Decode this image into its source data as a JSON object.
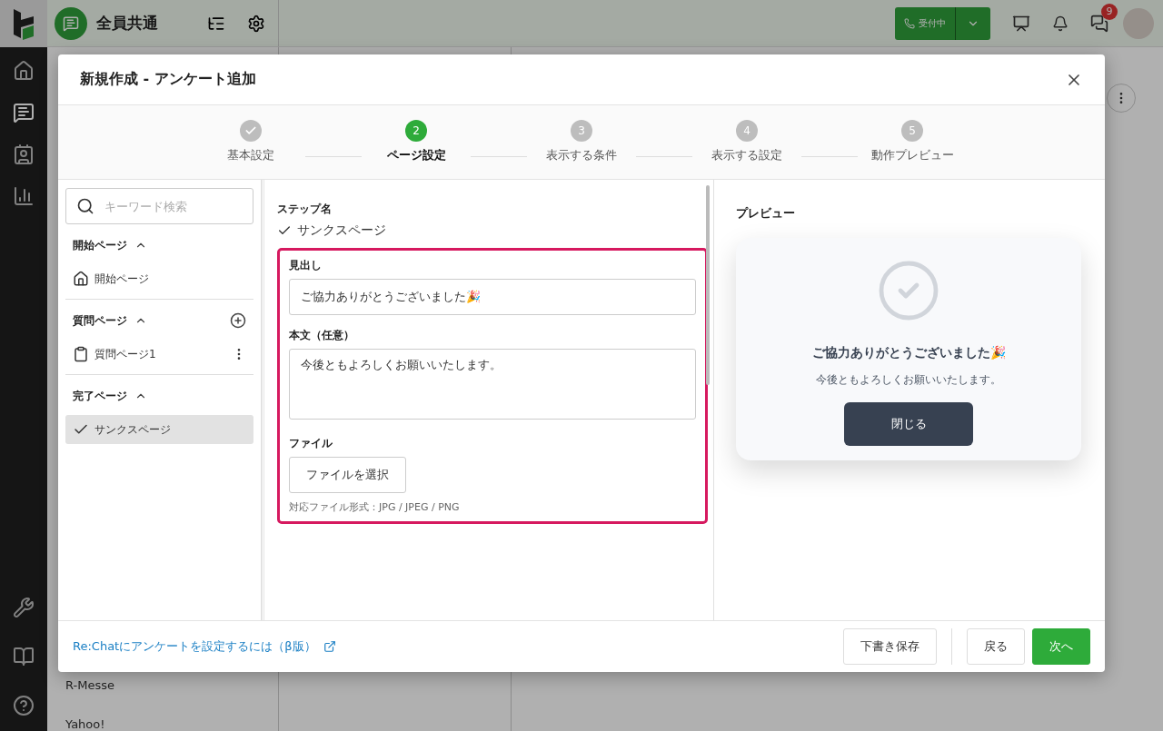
{
  "app": {
    "workspace": "全員共通",
    "status_button": "受付中",
    "notification_count": "9",
    "list_items": [
      "R-Messe",
      "Yahoo!"
    ]
  },
  "nav": [
    {
      "kind": "home",
      "selected": false
    },
    {
      "kind": "inbox",
      "selected": true
    },
    {
      "kind": "contacts",
      "selected": false
    },
    {
      "kind": "chart",
      "selected": false
    }
  ],
  "nav_bottom": [
    {
      "kind": "tools"
    },
    {
      "kind": "book"
    },
    {
      "kind": "help"
    }
  ],
  "dialog": {
    "title": "新規作成 - アンケート追加",
    "steps": [
      {
        "label": "基本設定",
        "kind": "done"
      },
      {
        "label": "ページ設定",
        "kind": "current",
        "number": "2"
      },
      {
        "label": "表示する条件",
        "kind": "todo",
        "number": "3"
      },
      {
        "label": "表示する設定",
        "kind": "todo",
        "number": "4"
      },
      {
        "label": "動作プレビュー",
        "kind": "todo",
        "number": "5"
      }
    ],
    "search": {
      "placeholder": "キーワード検索"
    },
    "sections": [
      {
        "title": "開始ページ",
        "expanded": true,
        "addable": false,
        "items": [
          {
            "label": "開始ページ",
            "kind": "home",
            "selected": false,
            "has_menu": false
          }
        ]
      },
      {
        "title": "質問ページ",
        "expanded": true,
        "addable": true,
        "items": [
          {
            "label": "質問ページ1",
            "kind": "clipboard",
            "selected": false,
            "has_menu": true
          }
        ]
      },
      {
        "title": "完了ページ",
        "expanded": true,
        "addable": false,
        "items": [
          {
            "label": "サンクスページ",
            "kind": "check",
            "selected": true,
            "has_menu": false
          }
        ]
      }
    ],
    "form": {
      "step_name_label": "ステップ名",
      "step_name": "サンクスページ",
      "heading_label": "見出し",
      "heading_value": "ご協力ありがとうございました🎉",
      "body_label": "本文（任意）",
      "body_value": "今後ともよろしくお願いいたします。",
      "file_label": "ファイル",
      "file_button": "ファイルを選択",
      "file_hint": "対応ファイル形式：JPG / JPEG / PNG"
    },
    "preview": {
      "title": "プレビュー",
      "heading": "ご協力ありがとうございました🎉",
      "body": "今後ともよろしくお願いいたします。",
      "button": "閉じる"
    },
    "footer": {
      "help_link": "Re:Chatにアンケートを設定するには（β版）",
      "buttons": [
        {
          "label": "下書き保存",
          "kind": "secondary"
        },
        {
          "label": "戻る",
          "kind": "secondary"
        },
        {
          "label": "次へ",
          "kind": "primary"
        }
      ]
    }
  }
}
